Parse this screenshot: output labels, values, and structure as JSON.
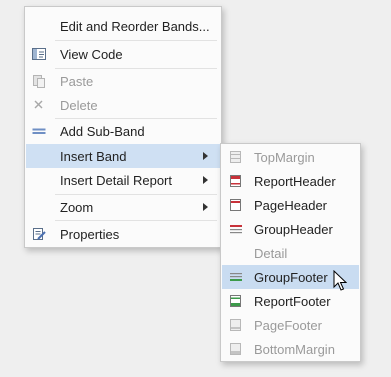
{
  "main_menu": {
    "items": [
      {
        "label": "Edit and Reorder Bands...",
        "icon": "none",
        "enabled": true
      },
      {
        "label": "View Code",
        "icon": "view-code-icon",
        "enabled": true
      },
      {
        "label": "Paste",
        "icon": "paste-icon",
        "enabled": false
      },
      {
        "label": "Delete",
        "icon": "delete-icon",
        "enabled": false
      },
      {
        "label": "Add Sub-Band",
        "icon": "add-sub-band-icon",
        "enabled": true
      },
      {
        "label": "Insert Band",
        "icon": "none",
        "enabled": true,
        "has_submenu": true,
        "active": true
      },
      {
        "label": "Insert Detail Report",
        "icon": "none",
        "enabled": true,
        "has_submenu": true
      },
      {
        "label": "Zoom",
        "icon": "none",
        "enabled": true,
        "has_submenu": true
      },
      {
        "label": "Properties",
        "icon": "properties-icon",
        "enabled": true
      }
    ]
  },
  "sub_menu": {
    "items": [
      {
        "label": "TopMargin",
        "icon": "top-margin-icon",
        "enabled": false
      },
      {
        "label": "ReportHeader",
        "icon": "report-header-icon",
        "enabled": true
      },
      {
        "label": "PageHeader",
        "icon": "page-header-icon",
        "enabled": true
      },
      {
        "label": "GroupHeader",
        "icon": "group-header-icon",
        "enabled": true
      },
      {
        "label": "Detail",
        "icon": "none",
        "enabled": false
      },
      {
        "label": "GroupFooter",
        "icon": "group-footer-icon",
        "enabled": true,
        "hover": true
      },
      {
        "label": "ReportFooter",
        "icon": "report-footer-icon",
        "enabled": true
      },
      {
        "label": "PageFooter",
        "icon": "page-footer-icon",
        "enabled": false
      },
      {
        "label": "BottomMargin",
        "icon": "bottom-margin-icon",
        "enabled": false
      }
    ]
  },
  "colors": {
    "highlight": "#cfe0f3",
    "band_red": "#c8323a",
    "band_green": "#3c9a4a",
    "disabled_text": "#9a9a9a"
  }
}
